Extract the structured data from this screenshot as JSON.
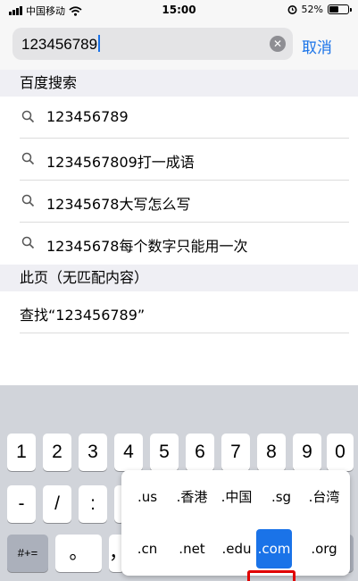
{
  "status_bar": {
    "carrier": "中国移动",
    "time": "15:00",
    "battery_percent": "52%",
    "battery_level": 0.52
  },
  "search": {
    "value": "123456789",
    "cancel_label": "取消"
  },
  "baidu_section": {
    "header": "百度搜索",
    "suggestions": [
      "123456789",
      "1234567809打一成语",
      "12345678大写怎么写",
      "12345678每个数字只能用一次"
    ]
  },
  "page_section": {
    "header": "此页（无匹配内容）",
    "find_label": "查找“123456789”"
  },
  "keyboard": {
    "row1": [
      "1",
      "2",
      "3",
      "4",
      "5",
      "6",
      "7",
      "8",
      "9",
      "0"
    ],
    "row2": [
      "-",
      "/",
      ":"
    ],
    "row3_left": "#+=",
    "row3_dot": "。",
    "row3_comma": "，"
  },
  "domain_popup": {
    "row1": [
      ".us",
      ".香港",
      ".中国",
      ".sg",
      ".台湾"
    ],
    "row2": [
      ".cn",
      ".net",
      ".edu",
      ".com",
      ".org"
    ],
    "selected": ".com"
  },
  "colors": {
    "accent": "#1a73e8",
    "annotation": "#e00000"
  }
}
